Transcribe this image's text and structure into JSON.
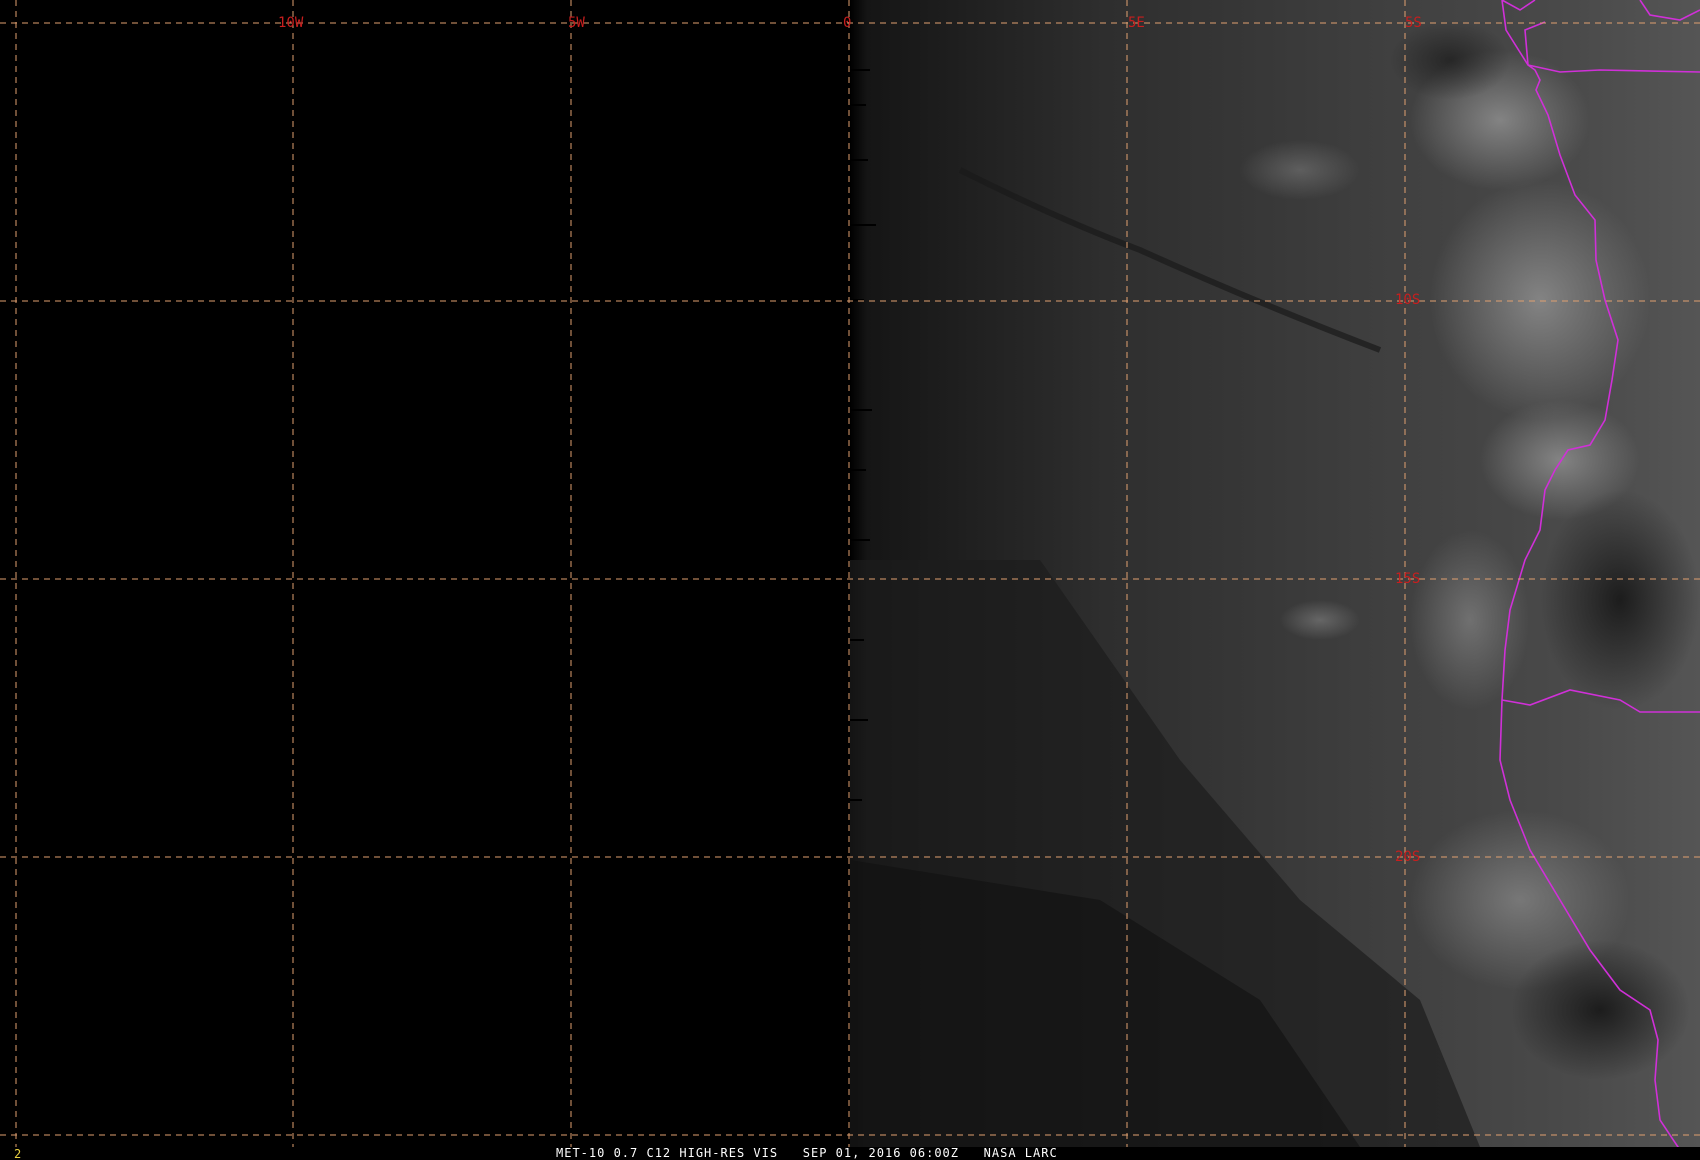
{
  "image": {
    "frame_number": "2",
    "caption": "MET-10 0.7 C12 HIGH-RES VIS   SEP 01, 2016 06:00Z   NASA LARC"
  },
  "grid": {
    "longitudes": [
      {
        "label": "10W"
      },
      {
        "label": "5W"
      },
      {
        "label": "0"
      },
      {
        "label": "5E"
      },
      {
        "label": "5S",
        "note": "top-right corner label"
      }
    ],
    "latitudes": [
      {
        "label": "10S"
      },
      {
        "label": "15S"
      },
      {
        "label": "20S"
      }
    ],
    "line_color": "#e0a070",
    "label_color": "#c81e1e"
  },
  "overlays": {
    "coastline_color": "#d030d8"
  }
}
